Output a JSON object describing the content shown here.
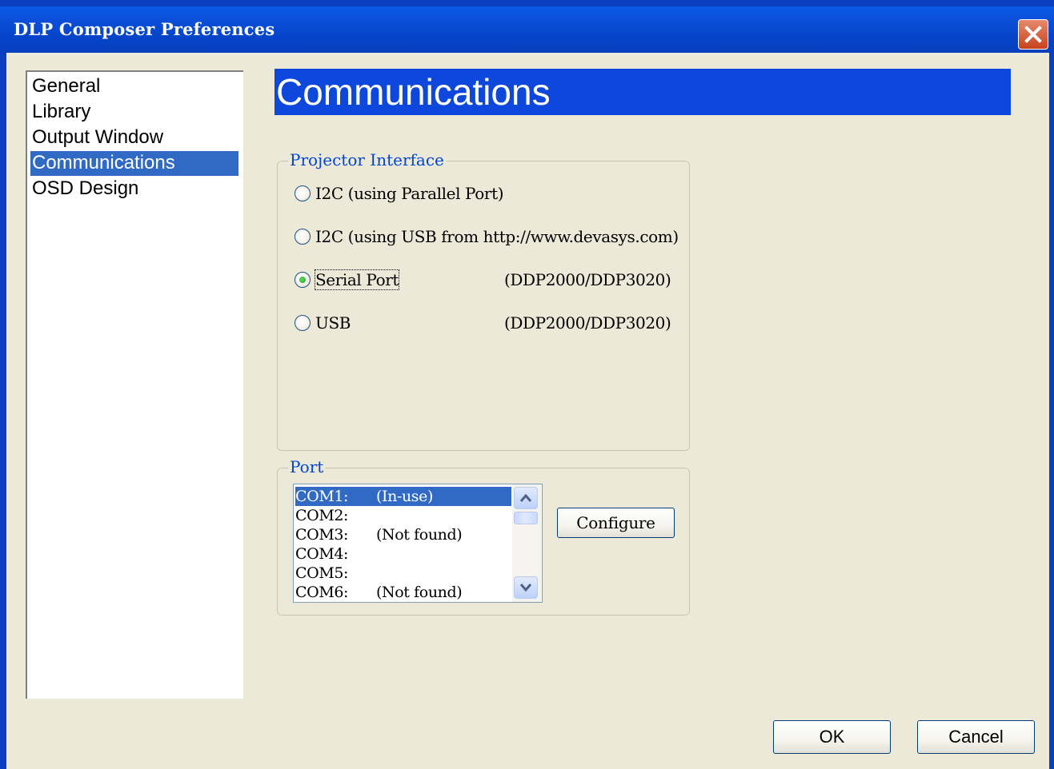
{
  "window": {
    "title": "DLP Composer Preferences"
  },
  "sidebar": {
    "items": [
      {
        "label": "General"
      },
      {
        "label": "Library"
      },
      {
        "label": "Output Window"
      },
      {
        "label": "Communications",
        "selected": true
      },
      {
        "label": "OSD Design"
      }
    ]
  },
  "page": {
    "header": "Communications"
  },
  "projector_interface": {
    "legend": "Projector Interface",
    "options": [
      {
        "label": "I2C (using Parallel Port)",
        "note": "",
        "selected": false
      },
      {
        "label": "I2C (using USB from http://www.devasys.com)",
        "note": "",
        "selected": false
      },
      {
        "label": "Serial Port",
        "note": "(DDP2000/DDP3020)",
        "selected": true
      },
      {
        "label": "USB",
        "note": "(DDP2000/DDP3020)",
        "selected": false
      }
    ]
  },
  "port": {
    "legend": "Port",
    "items": [
      {
        "name": "COM1:",
        "status": "(In-use)",
        "selected": true
      },
      {
        "name": "COM2:",
        "status": ""
      },
      {
        "name": "COM3:",
        "status": "(Not found)"
      },
      {
        "name": "COM4:",
        "status": ""
      },
      {
        "name": "COM5:",
        "status": ""
      },
      {
        "name": "COM6:",
        "status": "(Not found)"
      }
    ],
    "configure_label": "Configure"
  },
  "footer": {
    "ok_label": "OK",
    "cancel_label": "Cancel"
  },
  "icons": {
    "close": "close-icon",
    "scroll_up": "chevron-up-icon",
    "scroll_down": "chevron-down-icon"
  },
  "colors": {
    "titlebar": "#0543c8",
    "selection": "#316ac5",
    "header": "#0e47dc",
    "group_legend": "#0046d5",
    "close_button": "#c8421c"
  }
}
